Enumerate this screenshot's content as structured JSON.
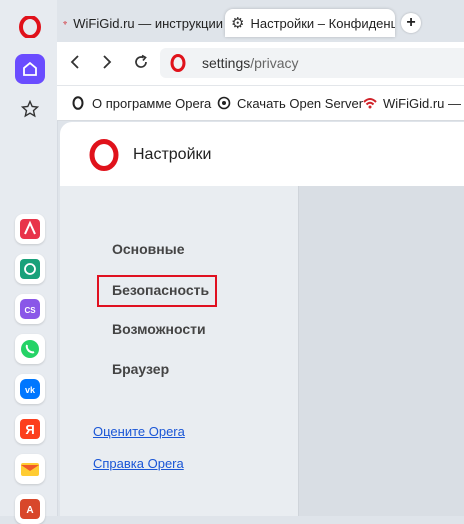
{
  "tabs": [
    {
      "label": "WiFiGid.ru — инструкции"
    },
    {
      "label": "Настройки – Конфиденц"
    }
  ],
  "address": {
    "scheme_host": "settings",
    "path": "/privacy"
  },
  "bookmarks": [
    {
      "label": "О программе Opera"
    },
    {
      "label": "Скачать Open Server"
    },
    {
      "label": "WiFiGid.ru — и"
    }
  ],
  "settings": {
    "title": "Настройки",
    "nav": [
      "Основные",
      "Безопасность",
      "Возможности",
      "Браузер"
    ],
    "links": [
      "Оцените Opera",
      "Справка Opera"
    ]
  },
  "colors": {
    "opera_red": "#e0121b",
    "accent_purple": "#6a4cff",
    "highlight": "#e01020",
    "link": "#1a56d6"
  },
  "sidebar_apps": [
    "aria-icon",
    "chatgpt-icon",
    "cs-icon",
    "whatsapp-icon",
    "vk-icon",
    "yandex-icon",
    "mail-icon",
    "translate-icon"
  ]
}
